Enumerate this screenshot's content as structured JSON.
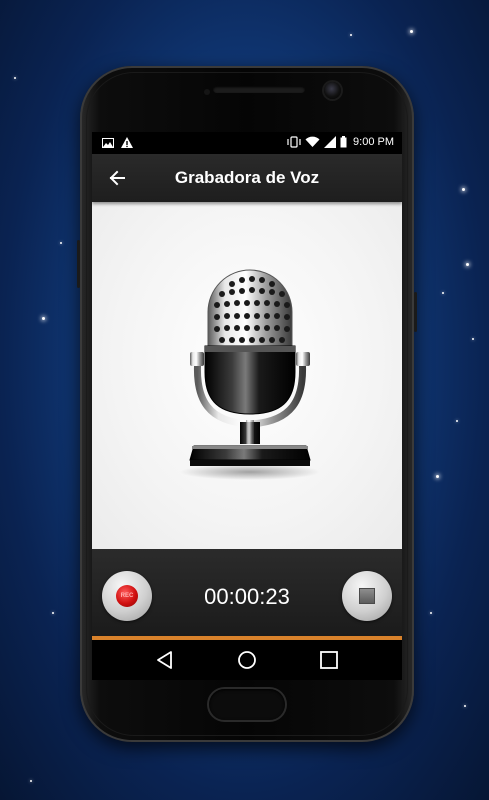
{
  "status_bar": {
    "time": "9:00 PM",
    "icons": [
      "image-icon",
      "warning-icon",
      "vibrate-icon",
      "wifi-icon",
      "signal-icon",
      "battery-icon"
    ]
  },
  "toolbar": {
    "title": "Grabadora de Voz",
    "back_icon": "back-arrow-icon"
  },
  "recorder": {
    "timer": "00:00:23",
    "record_button_text": "REC",
    "progress_fraction": 1.0,
    "accent_color": "#d9822b",
    "record_color": "#d01010"
  },
  "nav": {
    "buttons": [
      "back-triangle-icon",
      "home-circle-icon",
      "recents-square-icon"
    ]
  }
}
